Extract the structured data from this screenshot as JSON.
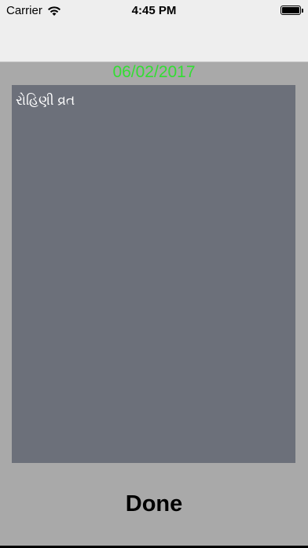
{
  "status_bar": {
    "carrier": "Carrier",
    "time": "4:45 PM",
    "battery_level": 1.0
  },
  "header": {
    "date": "06/02/2017"
  },
  "content": {
    "text": "રોહિણી વ્રત"
  },
  "footer": {
    "done_label": "Done"
  },
  "colors": {
    "date_text": "#33dd33",
    "panel_background": "#6c707a",
    "page_background": "#a9a9a9"
  }
}
